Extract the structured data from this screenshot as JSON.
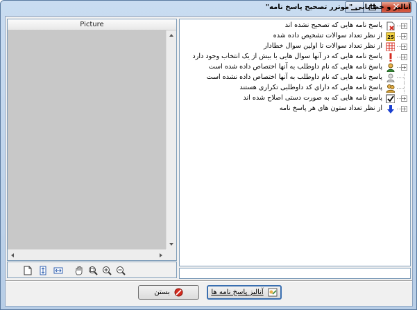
{
  "window": {
    "title": "آنالیز و خطایابی \"موترر تصحیح پاسخ نامه\""
  },
  "picture_panel": {
    "header": "Picture"
  },
  "tree": {
    "items": [
      {
        "text": "پاسخ نامه هایی که تصحیح نشده اند",
        "icon": "sheet-x-icon",
        "expander": "+"
      },
      {
        "text": "از نظر تعداد سوالات تشخیص داده شده",
        "icon": "count-25-icon",
        "expander": "+"
      },
      {
        "text": "از نظر تعداد سوالات تا اولین سوال خطادار",
        "icon": "grid-error-icon",
        "expander": "+"
      },
      {
        "text": "پاسخ نامه هایی که در آنها سوال هایی با بیش از یک انتخاب وجود دارد",
        "icon": "exclamation-icon",
        "expander": "+"
      },
      {
        "text": "پاسخ نامه هایی که نام داوطلب به آنها اختصاص داده شده است",
        "icon": "user-icon",
        "expander": "+"
      },
      {
        "text": "پاسخ نامه هایی که نام داوطلب به آنها اختصاص داده نشده است",
        "icon": "user-gray-icon",
        "expander": ""
      },
      {
        "text": "پاسخ نامه هایی که دارای کد داوطلبی تکراری هستند",
        "icon": "user-duplicate-icon",
        "expander": ""
      },
      {
        "text": "پاسخ نامه هایی که به صورت دستی اصلاح شده اند",
        "icon": "checkbox-icon",
        "expander": "+"
      },
      {
        "text": "از نظر تعداد ستون های هر پاسخ نامه",
        "icon": "arrow-down-icon",
        "expander": "+"
      }
    ]
  },
  "buttons": {
    "close_label": "بستن",
    "analyze_label": "آنالیز پاسخ نامه ها"
  },
  "colors": {
    "accent": "#3a6fb0",
    "close_red": "#d42a1e",
    "picture_bg": "#c8c8c8"
  }
}
